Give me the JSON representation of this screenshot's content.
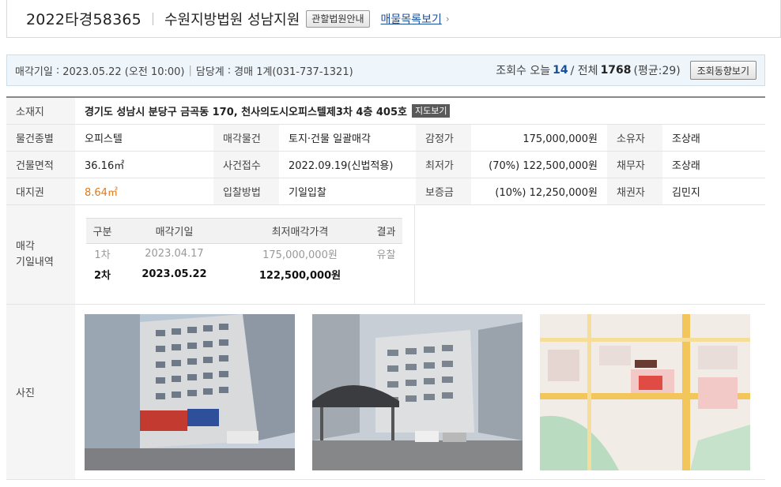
{
  "header": {
    "case_no": "2022타경58365",
    "court": "수원지방법원 성남지원",
    "court_info_btn": "관할법원안내",
    "list_link": "매물목록보기"
  },
  "infobar": {
    "sale_date_label": "매각기일",
    "sale_date": "2023.05.22 (오전 10:00)",
    "dept_label": "담당계",
    "dept": "경매 1계(031-737-1321)",
    "views_label": "조회수 오늘",
    "views_today": "14",
    "views_total_label": "/ 전체",
    "views_total": "1768",
    "views_avg": "(평균:29)",
    "trend_btn": "조회동향보기"
  },
  "detail": {
    "location_label": "소재지",
    "location": "경기도 성남시 분당구 금곡동 170, 천사의도시오피스텔제3차 4층 405호",
    "map_btn": "지도보기",
    "type_label": "물건종별",
    "type": "오피스텔",
    "sale_object_label": "매각물건",
    "sale_object": "토지·건물 일괄매각",
    "appraisal_label": "감정가",
    "appraisal": "175,000,000원",
    "owner_label": "소유자",
    "owner": "조상래",
    "building_area_label": "건물면적",
    "building_area": "36.16㎡",
    "case_date_label": "사건접수",
    "case_date": "2022.09.19(신법적용)",
    "min_price_label": "최저가",
    "min_price": "(70%) 122,500,000원",
    "debtor_label": "채무자",
    "debtor": "조상래",
    "land_right_label": "대지권",
    "land_right": "8.64㎡",
    "bid_method_label": "입찰방법",
    "bid_method": "기일입찰",
    "deposit_label": "보증금",
    "deposit": "(10%) 12,250,000원",
    "creditor_label": "채권자",
    "creditor": "김민지"
  },
  "history": {
    "label_line1": "매각",
    "label_line2": "기일내역",
    "headers": [
      "구분",
      "매각기일",
      "최저매각가격",
      "결과"
    ],
    "rows": [
      {
        "round": "1차",
        "date": "2023.04.17",
        "price": "175,000,000원",
        "result": "유찰"
      },
      {
        "round": "2차",
        "date": "2023.05.22",
        "price": "122,500,000원",
        "result": ""
      }
    ]
  },
  "photos": {
    "label": "사진"
  },
  "colors": {
    "link": "#1a4f9c",
    "accent_orange": "#e07a1a",
    "infobar_bg": "#eef5fb"
  }
}
